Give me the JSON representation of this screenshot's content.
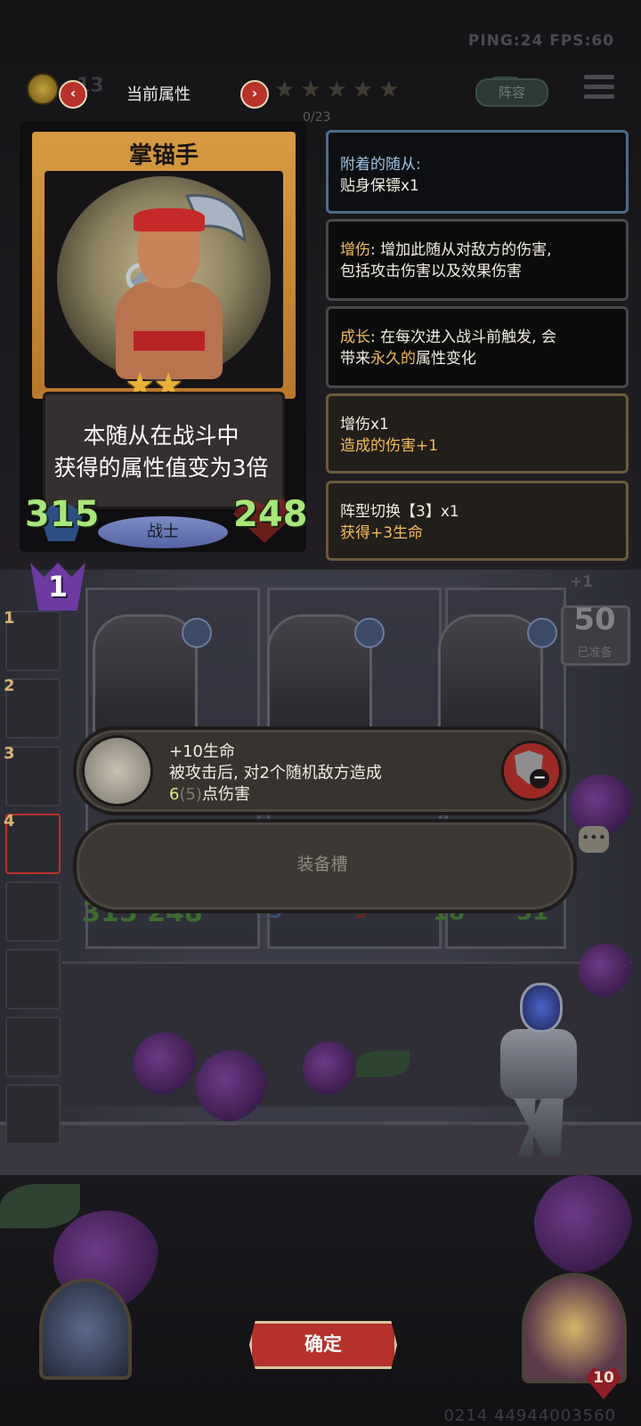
{
  "hud": {
    "ping_fps": "PING:24  FPS:60",
    "coins": "13",
    "attr_title": "当前属性",
    "prev_icon": "‹",
    "next_icon": "›",
    "stars": "★★★★★",
    "lineup": "阵容",
    "progress": "0/23"
  },
  "card": {
    "name": "掌锚手",
    "stars": "★★",
    "desc_line1": "本随从在战斗中",
    "desc_line2": "获得的属性值变为3倍",
    "attack": "315",
    "health": "248",
    "class": "战士"
  },
  "panels": [
    {
      "title": "附着的随从:",
      "body": "贴身保镖x1"
    },
    {
      "keyword": "增伤",
      "line1": ": 增加此随从对敌方的伤害,",
      "line2": "包括攻击伤害以及效果伤害"
    },
    {
      "keyword": "成长",
      "line1": ": 在每次进入战斗前触发, 会",
      "line2_pre": "带来",
      "line2_hl": "永久的",
      "line2_post": "属性变化"
    },
    {
      "title": "增伤x1",
      "body": "造成的伤害+1"
    },
    {
      "title": "阵型切换【3】x1",
      "body": "获得+3生命"
    }
  ],
  "board": {
    "rank": "1",
    "slots": [
      "1",
      "2",
      "3",
      "4"
    ],
    "refresh": "+1",
    "ready_count": "50",
    "ready_label": "已准备",
    "left_stats": "315 248",
    "mid_atk": "5",
    "mid_hp": "3",
    "right_atk": "18",
    "right_hp": "31"
  },
  "equipment": {
    "line1": "+10生命",
    "line2": "被攻击后, 对2个随机敌方造成",
    "line3_val": "6",
    "line3_dim": "(5)",
    "line3_post": "点伤害",
    "slot_label": "装备槽"
  },
  "bottom": {
    "confirm": "确定",
    "hero_health": "10",
    "player_id": "0214 44944003560"
  }
}
